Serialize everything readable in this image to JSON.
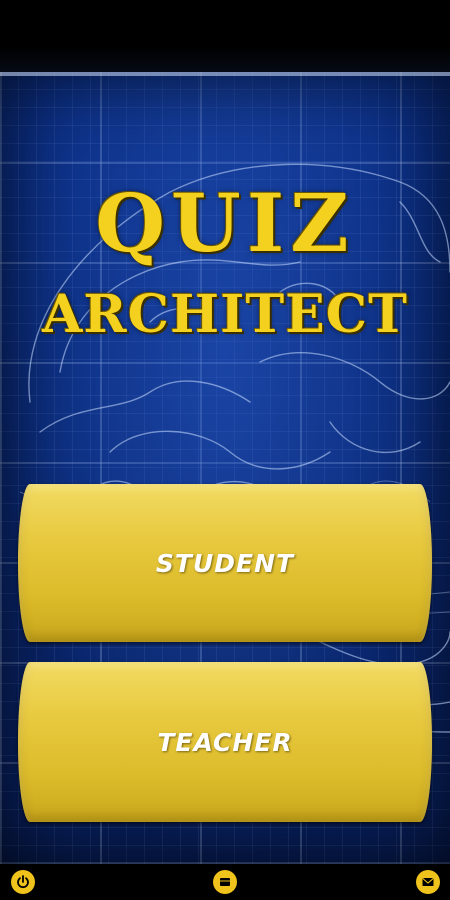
{
  "app": {
    "title_line1": "QUIZ",
    "title_line2": "ARCHITECT"
  },
  "menu": {
    "student_label": "STUDENT",
    "teacher_label": "TEACHER"
  },
  "bottom_bar": {
    "icons": [
      "power-icon",
      "book-icon",
      "mail-icon"
    ]
  },
  "colors": {
    "accent_yellow": "#f4d11e",
    "button_gold": "#e8c93f",
    "blueprint_blue": "#0a2a78"
  }
}
